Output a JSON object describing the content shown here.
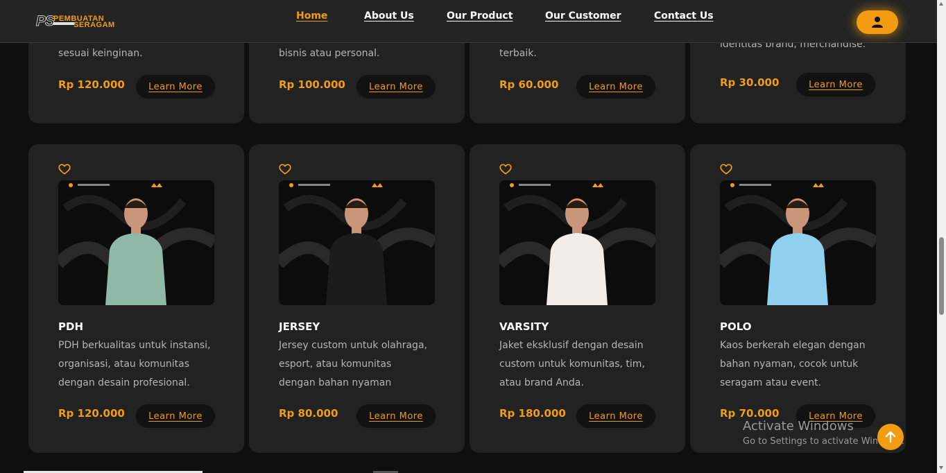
{
  "nav": {
    "logo_ps": "PS",
    "logo_line1": "PEMBUATAN",
    "logo_line2": "SERAGAM",
    "links": [
      "Home",
      "About Us",
      "Our Product",
      "Our Customer",
      "Contact Us"
    ],
    "active": "Home"
  },
  "top_cards": [
    {
      "desc_tail": "sesuai keinginan.",
      "price": "Rp 120.000",
      "button": "Learn More"
    },
    {
      "desc_tail": "bisnis atau personal.",
      "price": "Rp 100.000",
      "button": "Learn More"
    },
    {
      "desc_tail": "terbaik.",
      "price": "Rp 60.000",
      "button": "Learn More"
    },
    {
      "desc_tail": "identitas brand, merchandise.",
      "price": "Rp 30.000",
      "button": "Learn More"
    }
  ],
  "products": [
    {
      "title": "PDH",
      "desc": [
        "PDH berkualitas untuk instansi,",
        "organisasi, atau komunitas",
        "dengan desain profesional."
      ],
      "price": "Rp 120.000",
      "button": "Learn More",
      "shirt_color": "#8fb8a6"
    },
    {
      "title": "JERSEY",
      "desc": [
        "Jersey custom untuk olahraga,",
        "esport, atau komunitas",
        "dengan bahan nyaman"
      ],
      "price": "Rp 80.000",
      "button": "Learn More",
      "shirt_color": "#1c1c1c"
    },
    {
      "title": "VARSITY",
      "desc": [
        "Jaket eksklusif dengan desain",
        "custom untuk komunitas, tim,",
        "atau brand Anda."
      ],
      "price": "Rp 180.000",
      "button": "Learn More",
      "shirt_color": "#f2ece8"
    },
    {
      "title": "POLO",
      "desc": [
        "Kaos berkerah elegan dengan",
        "bahan nyaman, cocok untuk",
        "seragam atau event."
      ],
      "price": "Rp 70.000",
      "button": "Learn More",
      "shirt_color": "#8fd0ef"
    }
  ],
  "watermark": {
    "line1": "Activate Windows",
    "line2": "Go to Settings to activate Windows."
  },
  "colors": {
    "accent": "#f39c12",
    "card": "#222222",
    "background": "#0f0f0f"
  }
}
